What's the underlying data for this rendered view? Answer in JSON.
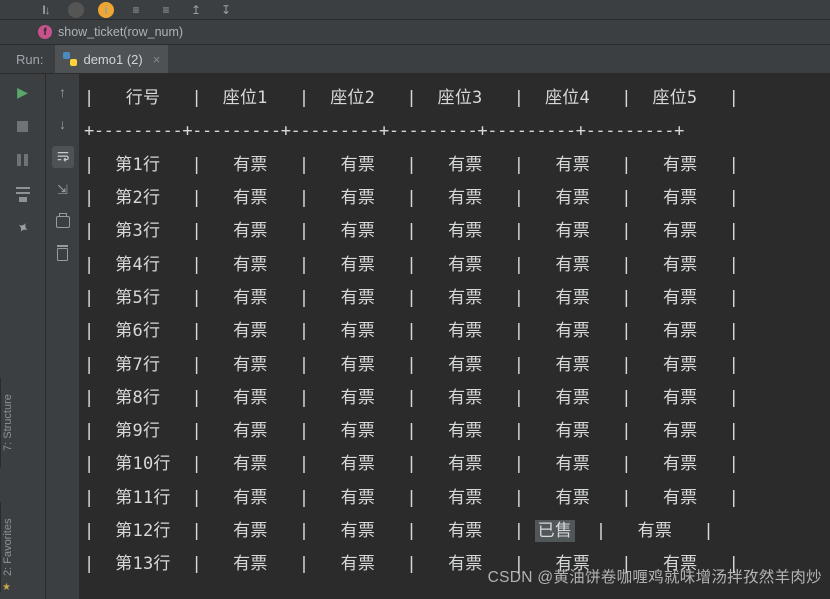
{
  "top_structure": {
    "function_label": "show_ticket(row_num)"
  },
  "run": {
    "label": "Run:",
    "tab_name": "demo1 (2)"
  },
  "sidebar": {
    "structure_label": "7: Structure",
    "favorites_label": "2: Favorites"
  },
  "watermark": "CSDN @黄油饼卷咖喱鸡就味增汤拌孜然羊肉炒",
  "table": {
    "headers": [
      "行号",
      "座位1",
      "座位2",
      "座位3",
      "座位4",
      "座位5"
    ],
    "available": "有票",
    "sold": "已售",
    "rows": [
      {
        "label": "第1行",
        "cells": [
          "有票",
          "有票",
          "有票",
          "有票",
          "有票"
        ]
      },
      {
        "label": "第2行",
        "cells": [
          "有票",
          "有票",
          "有票",
          "有票",
          "有票"
        ]
      },
      {
        "label": "第3行",
        "cells": [
          "有票",
          "有票",
          "有票",
          "有票",
          "有票"
        ]
      },
      {
        "label": "第4行",
        "cells": [
          "有票",
          "有票",
          "有票",
          "有票",
          "有票"
        ]
      },
      {
        "label": "第5行",
        "cells": [
          "有票",
          "有票",
          "有票",
          "有票",
          "有票"
        ]
      },
      {
        "label": "第6行",
        "cells": [
          "有票",
          "有票",
          "有票",
          "有票",
          "有票"
        ]
      },
      {
        "label": "第7行",
        "cells": [
          "有票",
          "有票",
          "有票",
          "有票",
          "有票"
        ]
      },
      {
        "label": "第8行",
        "cells": [
          "有票",
          "有票",
          "有票",
          "有票",
          "有票"
        ]
      },
      {
        "label": "第9行",
        "cells": [
          "有票",
          "有票",
          "有票",
          "有票",
          "有票"
        ]
      },
      {
        "label": "第10行",
        "cells": [
          "有票",
          "有票",
          "有票",
          "有票",
          "有票"
        ]
      },
      {
        "label": "第11行",
        "cells": [
          "有票",
          "有票",
          "有票",
          "有票",
          "有票"
        ]
      },
      {
        "label": "第12行",
        "cells": [
          "有票",
          "有票",
          "有票",
          "已售",
          "有票"
        ]
      },
      {
        "label": "第13行",
        "cells": [
          "有票",
          "有票",
          "有票",
          "有票",
          "有票"
        ]
      }
    ]
  }
}
